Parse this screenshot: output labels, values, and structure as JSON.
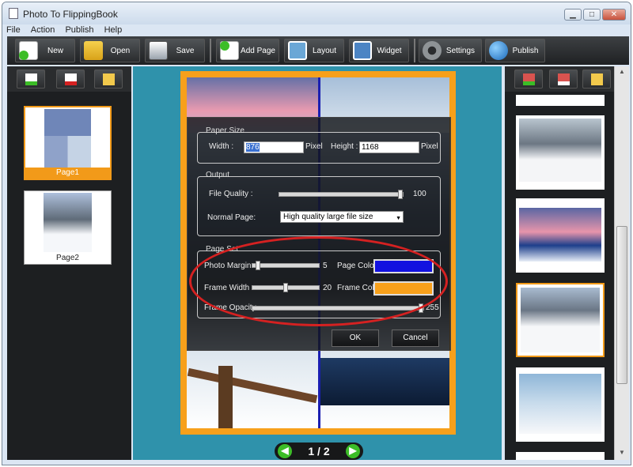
{
  "window": {
    "title": "Photo To FlippingBook",
    "minimize": "▁",
    "maximize": "□",
    "close": "✕"
  },
  "menu": [
    "File",
    "Action",
    "Publish",
    "Help"
  ],
  "toolbar": {
    "new": "New",
    "open": "Open",
    "save": "Save",
    "add_page": "Add Page",
    "layout": "Layout",
    "widget": "Widget",
    "settings": "Settings",
    "publish": "Publish"
  },
  "pages": [
    {
      "caption": "Page1",
      "selected": true
    },
    {
      "caption": "Page2",
      "selected": false
    }
  ],
  "dialog": {
    "paper_size": {
      "title": "Paper Size",
      "width_label": "Width :",
      "width_value": "876",
      "width_unit": "Pixel",
      "height_label": "Height :",
      "height_value": "1168",
      "height_unit": "Pixel"
    },
    "output": {
      "title": "Output",
      "file_quality_label": "File Quality :",
      "file_quality_value": "100",
      "file_quality_level": 1.0,
      "normal_page_label": "Normal Page:",
      "normal_page_value": "High quality large file size"
    },
    "page_set": {
      "title": "Page Set",
      "photo_margin_label": "Photo Margin",
      "photo_margin_value": "5",
      "photo_margin_level": 0.05,
      "frame_width_label": "Frame Width",
      "frame_width_value": "20",
      "frame_width_level": 0.5,
      "frame_opacity_label": "Frame Opacity",
      "frame_opacity_value": "255",
      "frame_opacity_level": 1.0,
      "page_color_label": "Page Color",
      "page_color": "#1212e0",
      "frame_color_label": "Frame Color",
      "frame_color": "#f7a01b"
    },
    "ok": "OK",
    "cancel": "Cancel"
  },
  "pager": {
    "prev": "◀",
    "text": "1 / 2",
    "next": "▶"
  },
  "colors": {
    "accent": "#f29a19",
    "canvas": "#2f92ab",
    "highlight_circle": "#d52121"
  }
}
